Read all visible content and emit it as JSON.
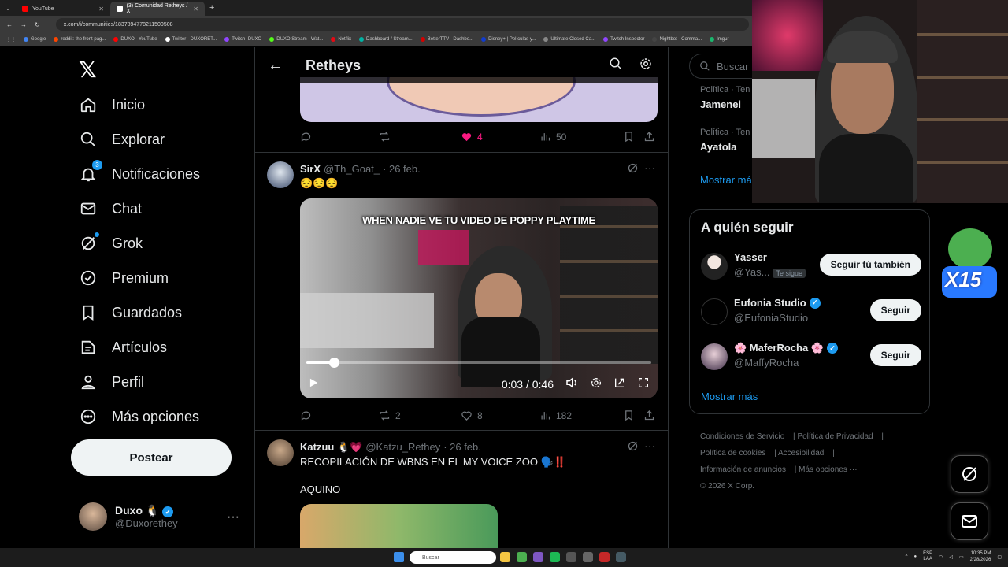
{
  "browser": {
    "tabs": [
      {
        "label": "YouTube",
        "color": "#ff0000"
      },
      {
        "label": "(3) Comunidad Retheys / X",
        "color": "#ffffff"
      }
    ],
    "url": "x.com/i/communities/1837894778211500508",
    "bookmarks": [
      "Google",
      "reddit: the front pag...",
      "DUXO - YouTube",
      "Twitter - DUXORET...",
      "Twitch- DUXO",
      "DUXO Stream - Wat...",
      "Netflix",
      "Dashboard / Stream...",
      "BetterTTV - Dashbo...",
      "Disney+ | Películas y...",
      "Ultimate Closed Ca...",
      "Twitch Inspector",
      "Nightbot - Comma...",
      "Imgur"
    ]
  },
  "nav": {
    "items": [
      {
        "label": "Inicio",
        "icon": "home-icon"
      },
      {
        "label": "Explorar",
        "icon": "search-icon"
      },
      {
        "label": "Notificaciones",
        "icon": "bell-icon",
        "badge": "3"
      },
      {
        "label": "Chat",
        "icon": "mail-icon"
      },
      {
        "label": "Grok",
        "icon": "grok-icon"
      },
      {
        "label": "Premium",
        "icon": "verified-icon"
      },
      {
        "label": "Guardados",
        "icon": "bookmark-icon"
      },
      {
        "label": "Artículos",
        "icon": "article-icon"
      },
      {
        "label": "Perfil",
        "icon": "person-icon"
      },
      {
        "label": "Más opciones",
        "icon": "more-circle-icon"
      }
    ],
    "post_label": "Postear",
    "account": {
      "name": "Duxo 🐧",
      "handle": "@Duxorethey"
    }
  },
  "feed": {
    "title": "Retheys",
    "tweet0": {
      "likes": "4",
      "views": "50"
    },
    "tweet1": {
      "name": "SirX",
      "handle": "@Th_Goat_",
      "date": "· 26 feb.",
      "text": "😔😔😔",
      "video_caption": "WHEN NADIE VE TU VIDEO DE POPPY PLAYTIME",
      "video_time": "0:03 / 0:46",
      "video_progress": 0.08,
      "replies": "",
      "retweets": "2",
      "likes": "8",
      "views": "182"
    },
    "tweet2": {
      "name": "Katzuu 🐧💗",
      "handle": "@Katzu_Rethey",
      "date": "· 26 feb.",
      "text": "RECOPILACIÓN DE WBNS EN EL MY VOICE ZOO 🗣️‼️",
      "text2": "AQUINO"
    }
  },
  "sidebar": {
    "search_placeholder": "Buscar",
    "trends": [
      {
        "category": "Política · Ten",
        "name": "Jamenei"
      },
      {
        "category": "Política · Ten",
        "name": "Ayatola"
      }
    ],
    "show_more_trends": "Mostrar má",
    "follow_title": "A quién seguir",
    "follow": [
      {
        "name": "Yasser",
        "handle": "@Yas...",
        "tag": "Te sigue",
        "button": "Seguir tú también"
      },
      {
        "name": "Eufonia Studio",
        "handle": "@EufoniaStudio",
        "button": "Seguir"
      },
      {
        "name": "🌸 MaferRocha 🌸",
        "handle": "@MaffyRocha",
        "button": "Seguir"
      }
    ],
    "show_more": "Mostrar más",
    "footer": [
      "Condiciones de Servicio",
      "Política de Privacidad",
      "Política de cookies",
      "Accesibilidad",
      "Información de anuncios",
      "Más opciones ···",
      "© 2026 X Corp."
    ]
  },
  "overlay": {
    "emote_text": "X15"
  },
  "taskbar": {
    "search": "Buscar",
    "lang1": "ESP",
    "lang2": "LAA",
    "time": "10:35 PM",
    "date": "2/28/2026"
  },
  "colors": {
    "accent": "#1d9bf0",
    "like": "#f91880",
    "bg": "#000000",
    "border": "#2f3336"
  }
}
